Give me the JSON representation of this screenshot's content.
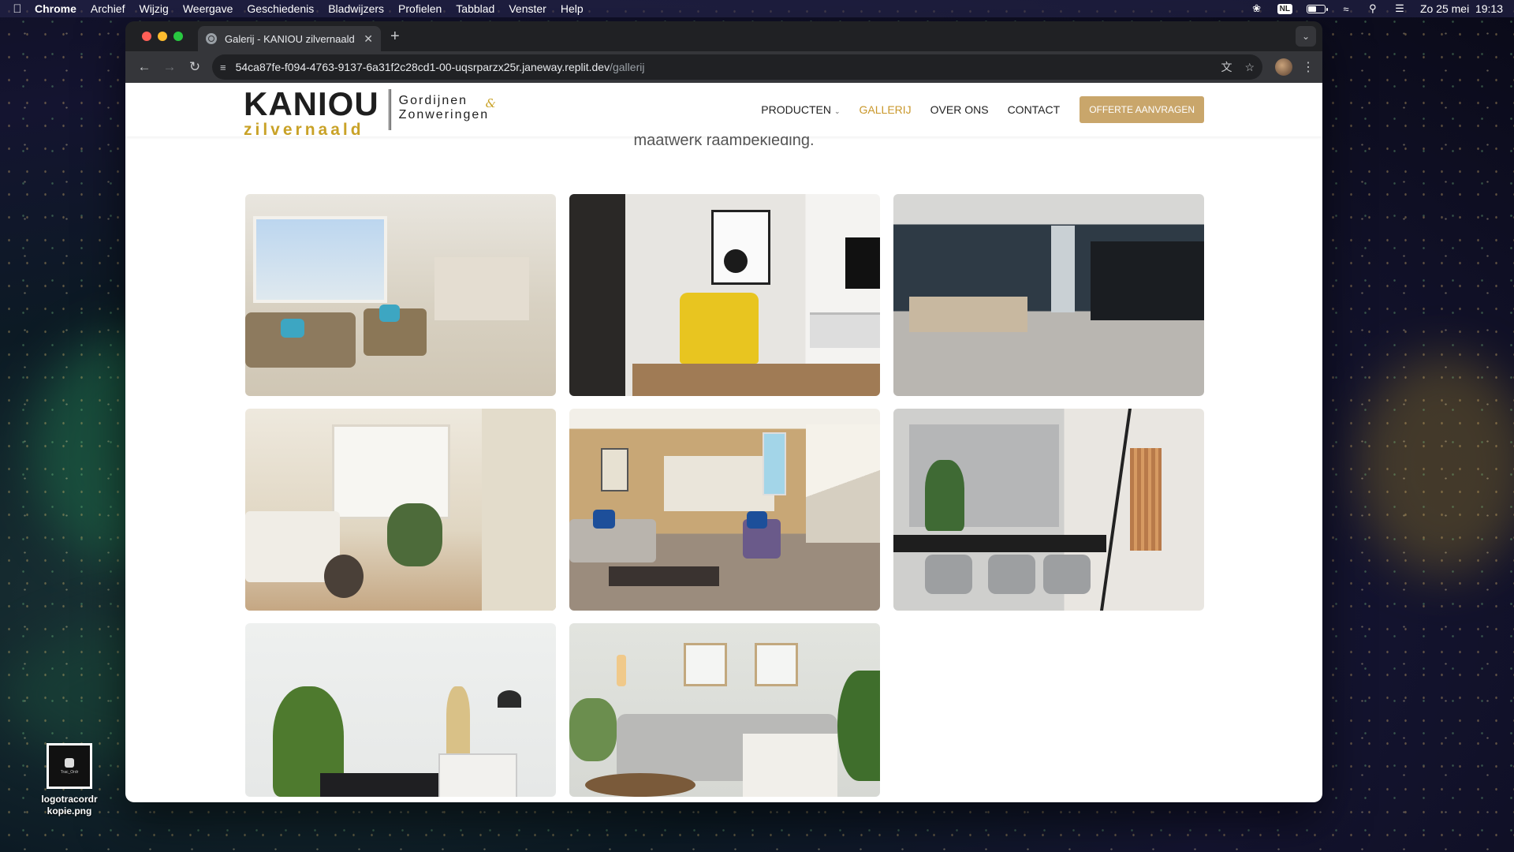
{
  "menubar": {
    "app": "Chrome",
    "items": [
      "Archief",
      "Wijzig",
      "Weergave",
      "Geschiedenis",
      "Bladwijzers",
      "Profielen",
      "Tabblad",
      "Venster",
      "Help"
    ],
    "language": "NL",
    "datetime": "Zo 25 mei  19:13"
  },
  "browser": {
    "tab_title": "Galerij - KANIOU zilvernaald",
    "url_host": "54ca87fe-f094-4763-9137-6a31f2c28cd1-00-uqsrparzx25r.janeway.replit.dev",
    "url_path": "/gallerij"
  },
  "site": {
    "logo_main": "KANIOU",
    "logo_sub": "zilvernaald",
    "logo_line1": "Gordijnen",
    "logo_line2": "Zonweringen",
    "logo_amp": "&",
    "nav": {
      "producten": "PRODUCTEN",
      "gallerij": "GALLERIJ",
      "over_ons": "OVER ONS",
      "contact": "CONTACT",
      "cta": "OFFERTE AANVRAGEN"
    },
    "subtitle": "maatwerk raambekleding."
  },
  "desktop": {
    "file_label": "logotracordr kopie.png",
    "file_thumb_text": "Trac_Ordr"
  },
  "colors": {
    "gold": "#c9a227",
    "active_nav": "#c9972a",
    "cta_bg": "#c9a66b"
  }
}
